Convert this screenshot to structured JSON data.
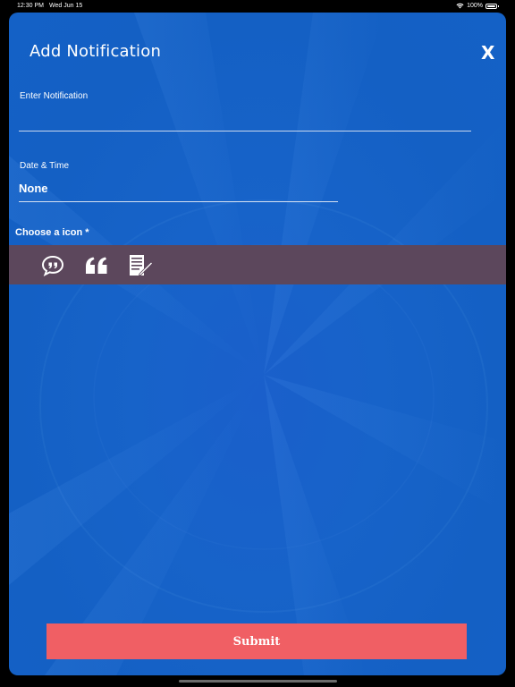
{
  "status_bar": {
    "time": "12:30 PM",
    "date": "Wed Jun 15",
    "battery": "100%"
  },
  "modal": {
    "title": "Add Notification",
    "close_label": "X"
  },
  "form": {
    "notification_label": "Enter Notification",
    "notification_value": "",
    "datetime_label": "Date & Time",
    "datetime_value": "None",
    "icon_chooser_label": "Choose a icon *",
    "icons": [
      "speech-bubble-quote-icon",
      "quote-icon",
      "note-edit-icon"
    ]
  },
  "submit": {
    "label": "Submit"
  },
  "colors": {
    "background": "#1461c6",
    "icon_bar": "#5c475c",
    "submit_button": "#f05f64"
  }
}
